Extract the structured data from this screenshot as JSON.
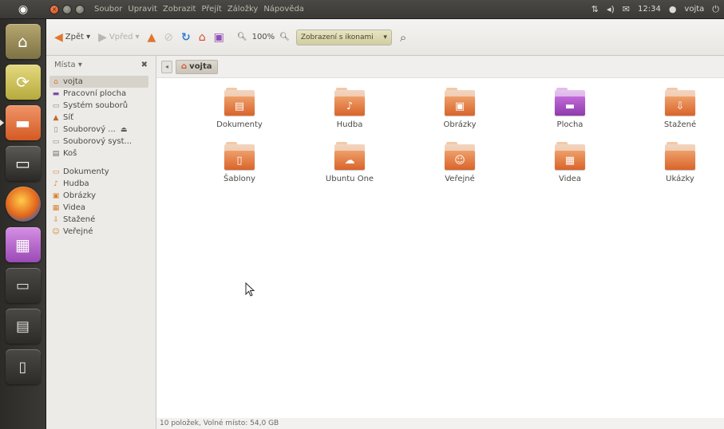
{
  "panel": {
    "menu": [
      "Soubor",
      "Upravit",
      "Zobrazit",
      "Přejít",
      "Záložky",
      "Nápověda"
    ],
    "clock": "12:34",
    "user": "vojta"
  },
  "launcher": {
    "items": [
      "home-folder-icon",
      "update-manager-icon",
      "files-icon",
      "terminal-icon",
      "firefox-icon",
      "workspaces-icon",
      "folder-icon",
      "calendar-icon",
      "trash-icon"
    ]
  },
  "toolbar": {
    "back_label": "Zpět",
    "forward_label": "Vpřed",
    "zoom_level": "100%",
    "view_mode": "Zobrazení s ikonami"
  },
  "sidebar": {
    "header": "Místa",
    "places": [
      {
        "label": "vojta",
        "icon": "home-icon",
        "selected": true
      },
      {
        "label": "Pracovní plocha",
        "icon": "desktop-icon"
      },
      {
        "label": "Systém souborů",
        "icon": "filesystem-icon"
      },
      {
        "label": "Síť",
        "icon": "network-icon"
      }
    ],
    "devices": [
      {
        "label": "Souborový ...",
        "icon": "drive-icon",
        "eject": true
      },
      {
        "label": "Souborový syst...",
        "icon": "drive-icon"
      }
    ],
    "trash": {
      "label": "Koš",
      "icon": "trash-icon"
    },
    "bookmarks": [
      {
        "label": "Dokumenty",
        "icon": "folder-icon"
      },
      {
        "label": "Hudba",
        "icon": "folder-icon"
      },
      {
        "label": "Obrázky",
        "icon": "folder-icon"
      },
      {
        "label": "Videa",
        "icon": "folder-icon"
      },
      {
        "label": "Stažené",
        "icon": "folder-icon"
      },
      {
        "label": "Veřejné",
        "icon": "folder-icon"
      }
    ]
  },
  "pathbar": {
    "current": "vojta"
  },
  "files": [
    {
      "name": "Dokumenty",
      "icon": "documents-folder-icon"
    },
    {
      "name": "Hudba",
      "icon": "music-folder-icon"
    },
    {
      "name": "Obrázky",
      "icon": "pictures-folder-icon"
    },
    {
      "name": "Plocha",
      "icon": "desktop-folder-icon"
    },
    {
      "name": "Stažené",
      "icon": "downloads-folder-icon"
    },
    {
      "name": "Šablony",
      "icon": "templates-folder-icon"
    },
    {
      "name": "Ubuntu One",
      "icon": "ubuntu-one-folder-icon"
    },
    {
      "name": "Veřejné",
      "icon": "public-folder-icon"
    },
    {
      "name": "Videa",
      "icon": "videos-folder-icon"
    },
    {
      "name": "Ukázky",
      "icon": "examples-folder-icon"
    }
  ],
  "status": "10 položek, Volné místo: 54,0 GB",
  "colors": {
    "accent": "#e0762e",
    "panel": "#3c3b37",
    "selection": "#d7d3cb"
  }
}
